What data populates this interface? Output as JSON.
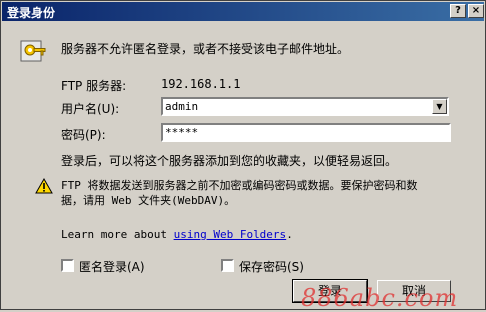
{
  "window": {
    "title": "登录身份",
    "help_button": "?",
    "close_button": "×"
  },
  "message": "服务器不允许匿名登录，或者不接受该电子邮件地址。",
  "server": {
    "label": "FTP 服务器:",
    "value": "192.168.1.1"
  },
  "username": {
    "label": "用户名(U):",
    "value": "admin"
  },
  "password": {
    "label": "密码(P):",
    "value": "*****"
  },
  "after_login_text": "登录后，可以将这个服务器添加到您的收藏夹，以便轻易返回。",
  "warning": {
    "icon": "warning-icon",
    "line1": "FTP 将数据发送到服务器之前不加密或编码密码或数据。要保护密码和数",
    "line2": "据，请用 Web 文件夹(WebDAV)。"
  },
  "learn_more": {
    "prefix": "Learn more about",
    "link": "using Web Folders",
    "suffix": "."
  },
  "anonymous_checkbox": {
    "label": "匿名登录(A)",
    "checked": false
  },
  "save_password_checkbox": {
    "label": "保存密码(S)",
    "checked": false
  },
  "buttons": {
    "login": "登录",
    "cancel": "取消"
  },
  "watermark": "886abc.com"
}
